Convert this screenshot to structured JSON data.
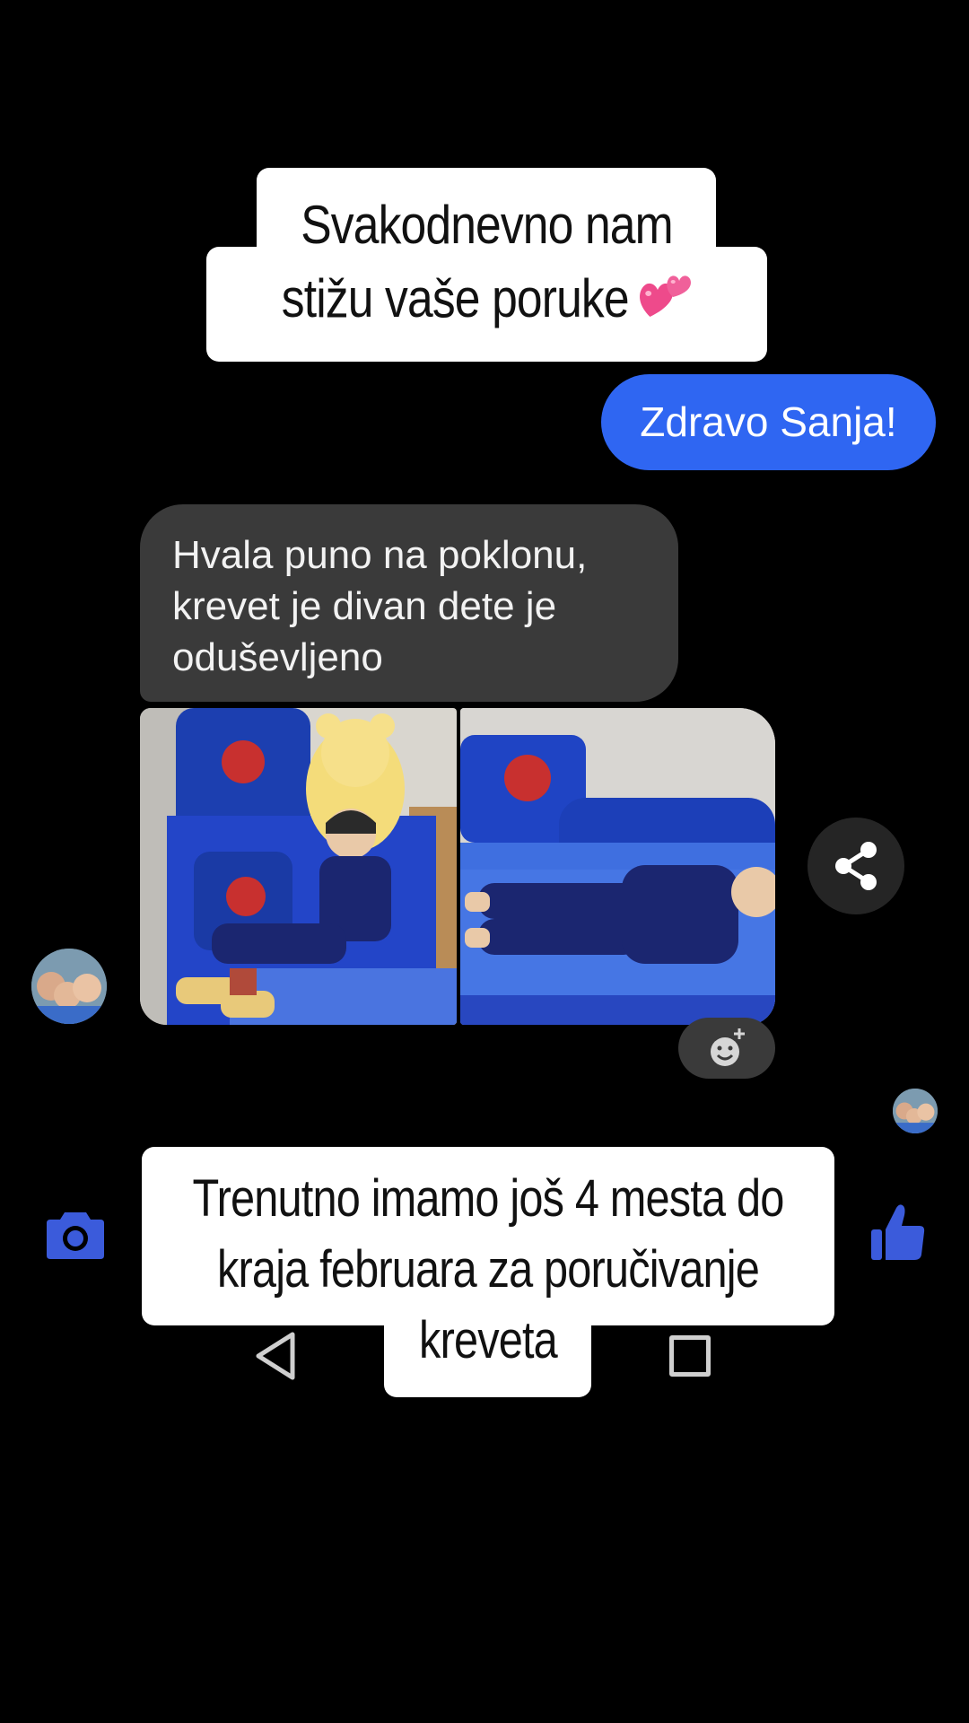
{
  "captions": {
    "top_line1": "Svakodnevno nam",
    "top_line2": "stižu vaše poruke",
    "top_emoji": "two-hearts-emoji",
    "bottom_line1": "Trenutno imamo još 4 mesta do",
    "bottom_line2": "kraja februara za poručivanje",
    "bottom_line3": "kreveta"
  },
  "messages": {
    "sent": {
      "text": "Zdravo Sanja!",
      "color": "#2f66f2"
    },
    "received": {
      "line1": "Hvala puno na poklonu,",
      "line2": "krevet je divan dete je",
      "line3": "oduševljeno",
      "color": "#3a3a3a"
    },
    "photos": [
      {
        "icon": "photo-child-sitting-on-bed"
      },
      {
        "icon": "photo-child-lying-on-bed"
      }
    ]
  },
  "actions": {
    "share_icon": "share-icon",
    "add_reaction_icon": "add-reaction-icon",
    "camera_icon": "camera-icon",
    "like_icon": "thumbs-up-icon",
    "accent": "#3b5bdb"
  },
  "nav": {
    "back_icon": "back-triangle-icon",
    "recents_icon": "recents-square-icon"
  }
}
